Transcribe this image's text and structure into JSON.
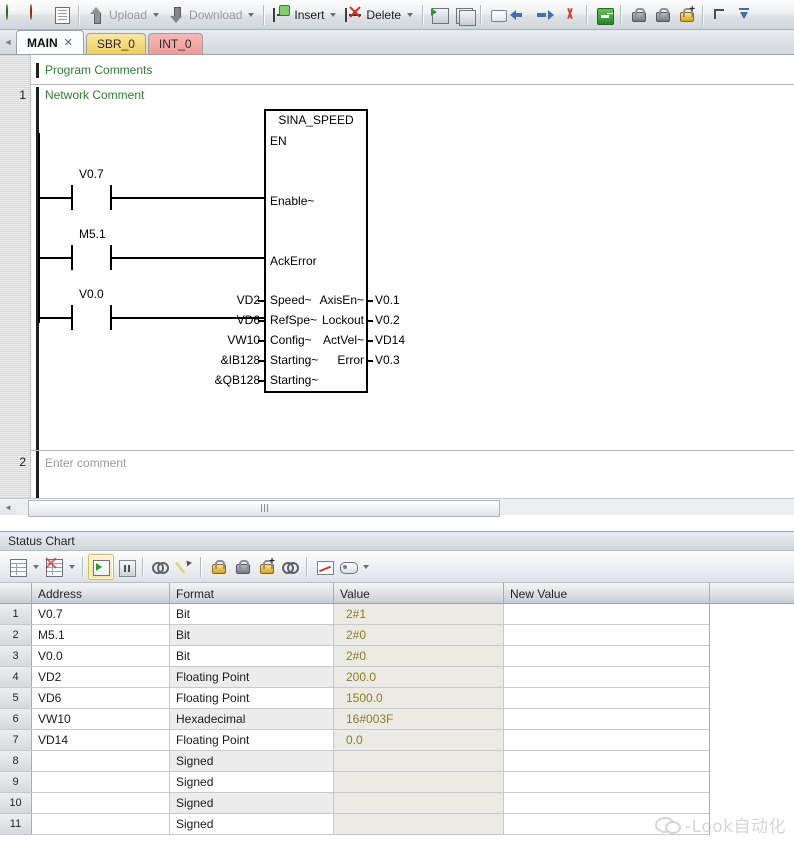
{
  "toolbar": {
    "items": [
      {
        "name": "run-button",
        "icon": "run-green-orb",
        "label": ""
      },
      {
        "name": "stop-button",
        "icon": "stop-red-orb",
        "label": ""
      },
      {
        "name": "compile-button",
        "icon": "compile-check-sheet-icon",
        "label": ""
      },
      {
        "name": "upload-button",
        "icon": "upload-arrow-icon",
        "label": "Upload",
        "dropdown": true,
        "disabled": true
      },
      {
        "name": "download-button",
        "icon": "download-arrow-icon",
        "label": "Download",
        "dropdown": true,
        "disabled": true
      },
      {
        "name": "insert-button",
        "icon": "insert-rung-icon",
        "label": "Insert",
        "dropdown": true,
        "disabled": false
      },
      {
        "name": "delete-button",
        "icon": "delete-rung-icon",
        "label": "Delete",
        "dropdown": true,
        "disabled": false
      },
      {
        "name": "compile-all-button",
        "icon": "compile-block-icon",
        "label": ""
      },
      {
        "name": "block-properties-button",
        "icon": "blocks-icon",
        "label": ""
      },
      {
        "name": "contact-button",
        "icon": "contact-box-icon",
        "label": ""
      },
      {
        "name": "undo-button",
        "icon": "arrow-left-blue-icon",
        "label": ""
      },
      {
        "name": "redo-button",
        "icon": "arrow-right-blue-icon",
        "label": ""
      },
      {
        "name": "cut-button",
        "icon": "scissors-icon",
        "label": ""
      },
      {
        "name": "goto-button",
        "icon": "green-arrow-square-icon",
        "label": ""
      },
      {
        "name": "password-lock-button",
        "icon": "lock-grey-icon",
        "label": ""
      },
      {
        "name": "unlock-button",
        "icon": "unlock-grey-icon",
        "label": ""
      },
      {
        "name": "add-lock-button",
        "icon": "lock-plus-icon",
        "label": ""
      },
      {
        "name": "toggle-tree-button",
        "icon": "branch-icon",
        "label": ""
      },
      {
        "name": "download-settings-button",
        "icon": "blue-down-icon",
        "label": ""
      }
    ]
  },
  "tabs": {
    "scroll_left": "◄",
    "items": [
      {
        "label": "MAIN",
        "active": true,
        "closable": true,
        "style": "active"
      },
      {
        "label": "SBR_0",
        "active": false,
        "closable": false,
        "style": "sbr"
      },
      {
        "label": "INT_0",
        "active": false,
        "closable": false,
        "style": "int"
      }
    ],
    "close_glyph": "✕"
  },
  "editor": {
    "program_comment": "Program Comments",
    "networks": [
      {
        "number": "1",
        "comment": "Network Comment"
      },
      {
        "number": "2",
        "comment": "Enter comment"
      }
    ],
    "rung": {
      "contacts": [
        {
          "address": "V0.7",
          "type": "normally-open-contact"
        },
        {
          "address": "M5.1",
          "type": "normally-open-contact"
        },
        {
          "address": "V0.0",
          "type": "normally-open-contact"
        }
      ],
      "block": {
        "title": "SINA_SPEED",
        "enable_pins": [
          "EN",
          "Enable~",
          "AckError"
        ],
        "inputs": [
          {
            "operand": "VD2",
            "pin": "Speed~"
          },
          {
            "operand": "VD6",
            "pin": "RefSpe~"
          },
          {
            "operand": "VW10",
            "pin": "Config~"
          },
          {
            "operand": "&IB128",
            "pin": "Starting~"
          },
          {
            "operand": "&QB128",
            "pin": "Starting~"
          }
        ],
        "outputs": [
          {
            "pin": "AxisEn~",
            "operand": "V0.1"
          },
          {
            "pin": "Lockout",
            "operand": "V0.2"
          },
          {
            "pin": "ActVel~",
            "operand": "VD14"
          },
          {
            "pin": "Error",
            "operand": "V0.3"
          }
        ]
      }
    },
    "hscroll": {
      "left_glyph": "◄",
      "grip": "|||"
    }
  },
  "status_chart": {
    "panel_title": "Status Chart",
    "toolbar_items": [
      {
        "name": "new-chart-button",
        "icon": "new-chart-icon",
        "dropdown": true
      },
      {
        "name": "cut-chart-button",
        "icon": "cut-chart-icon",
        "dropdown": true
      },
      {
        "name": "chart-status-on-button",
        "icon": "play-green-icon",
        "selected": true
      },
      {
        "name": "chart-status-pause-button",
        "icon": "pause-icon",
        "selected": false
      },
      {
        "name": "single-read-button",
        "icon": "binoculars-icon",
        "selected": false
      },
      {
        "name": "write-all-button",
        "icon": "pencil-icon",
        "selected": false
      },
      {
        "name": "force-button",
        "icon": "lock-yellow-icon",
        "selected": false
      },
      {
        "name": "unforce-button",
        "icon": "unlock-grey-icon",
        "selected": false
      },
      {
        "name": "unforce-all-button",
        "icon": "lock-plus-yellow-icon",
        "selected": false
      },
      {
        "name": "read-all-forced-button",
        "icon": "binoculars-lock-icon",
        "selected": false
      },
      {
        "name": "trend-view-button",
        "icon": "trend-chart-icon",
        "selected": false
      },
      {
        "name": "display-format-button",
        "icon": "tag-pill-icon",
        "dropdown": true
      }
    ],
    "columns": [
      "Address",
      "Format",
      "Value",
      "New Value"
    ],
    "rows": [
      {
        "num": "1",
        "address": "V0.7",
        "format": "Bit",
        "value": "2#1",
        "new_value": ""
      },
      {
        "num": "2",
        "address": "M5.1",
        "format": "Bit",
        "value": "2#0",
        "new_value": ""
      },
      {
        "num": "3",
        "address": "V0.0",
        "format": "Bit",
        "value": "2#0",
        "new_value": ""
      },
      {
        "num": "4",
        "address": "VD2",
        "format": "Floating Point",
        "value": "200.0",
        "new_value": ""
      },
      {
        "num": "5",
        "address": "VD6",
        "format": "Floating Point",
        "value": "1500.0",
        "new_value": ""
      },
      {
        "num": "6",
        "address": "VW10",
        "format": "Hexadecimal",
        "value": "16#003F",
        "new_value": ""
      },
      {
        "num": "7",
        "address": "VD14",
        "format": "Floating Point",
        "value": "0.0",
        "new_value": ""
      },
      {
        "num": "8",
        "address": "",
        "format": "Signed",
        "value": "",
        "new_value": ""
      },
      {
        "num": "9",
        "address": "",
        "format": "Signed",
        "value": "",
        "new_value": ""
      },
      {
        "num": "10",
        "address": "",
        "format": "Signed",
        "value": "",
        "new_value": ""
      },
      {
        "num": "11",
        "address": "",
        "format": "Signed",
        "value": "",
        "new_value": ""
      }
    ]
  },
  "watermark": {
    "text": "-Look自动化",
    "icon": "wechat-bubble-icon"
  },
  "colors": {
    "comment_green": "#2f7d32",
    "value_olive": "#8b7e23",
    "tab_sbr": "#efcd61",
    "tab_int": "#ef9a97"
  }
}
